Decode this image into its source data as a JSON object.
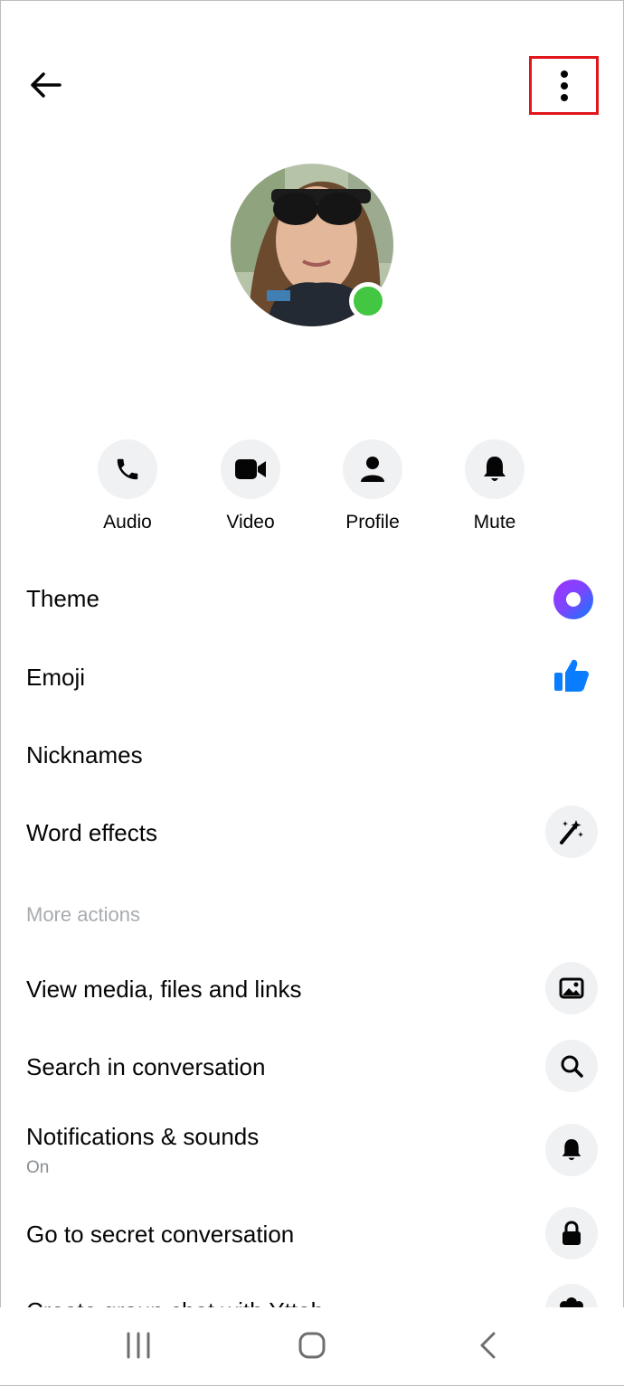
{
  "header": {
    "back_icon": "arrow-left-icon",
    "menu_icon": "more-vertical-icon"
  },
  "profile": {
    "status_color": "#43c641"
  },
  "actions": [
    {
      "label": "Audio",
      "icon": "phone-icon"
    },
    {
      "label": "Video",
      "icon": "video-camera-icon"
    },
    {
      "label": "Profile",
      "icon": "person-icon"
    },
    {
      "label": "Mute",
      "icon": "bell-icon"
    }
  ],
  "settings": {
    "theme": "Theme",
    "emoji": "Emoji",
    "nicknames": "Nicknames",
    "word_effects": "Word effects"
  },
  "more_actions": {
    "heading": "More actions",
    "view_media": "View media, files and links",
    "search": "Search in conversation",
    "notifications": "Notifications  & sounds",
    "notifications_status": "On",
    "secret": "Go to secret conversation",
    "create_group": "Create group chat with Yttah"
  },
  "colors": {
    "accent_blue": "#0a7cff",
    "highlight_red": "#e0161b"
  }
}
